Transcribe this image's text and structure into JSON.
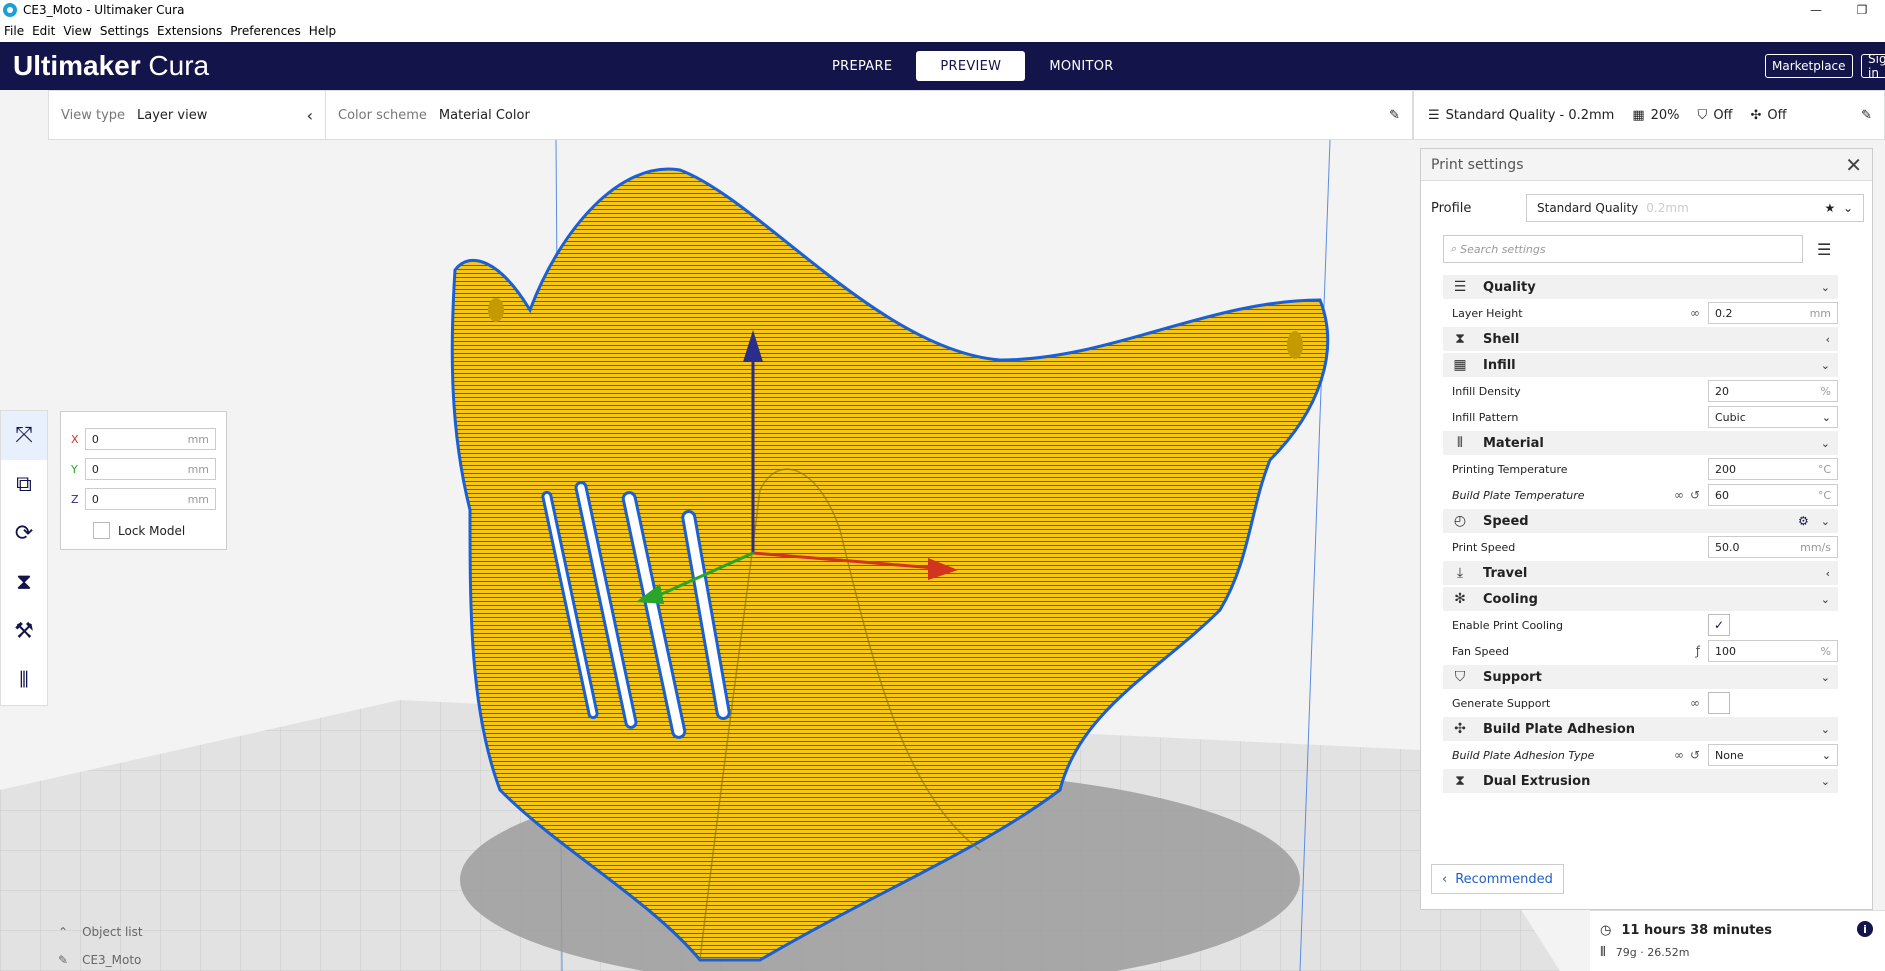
{
  "window": {
    "title": "CE3_Moto - Ultimaker Cura",
    "minimize": "—",
    "restore": "❐"
  },
  "menu": [
    "File",
    "Edit",
    "View",
    "Settings",
    "Extensions",
    "Preferences",
    "Help"
  ],
  "header": {
    "brand_bold": "Ultimaker",
    "brand_rest": " Cura",
    "tabs": [
      "PREPARE",
      "PREVIEW",
      "MONITOR"
    ],
    "active_tab": "PREVIEW",
    "marketplace": "Marketplace",
    "signin": "Sign in"
  },
  "view_bar": {
    "view_type_label": "View type",
    "view_type_value": "Layer view",
    "color_scheme_label": "Color scheme",
    "color_scheme_value": "Material Color"
  },
  "print_bar": {
    "profile": "Standard Quality - 0.2mm",
    "infill": "20%",
    "support": "Off",
    "adhesion": "Off"
  },
  "tools": [
    "move-tool",
    "scale-tool",
    "rotate-tool",
    "mirror-tool",
    "per-model-settings-tool",
    "support-blocker-tool"
  ],
  "move_panel": {
    "x_label": "X",
    "x_value": "0",
    "y_label": "Y",
    "y_value": "0",
    "z_label": "Z",
    "z_value": "0",
    "unit": "mm",
    "lock_label": "Lock Model",
    "lock_checked": false
  },
  "object_list": {
    "label": "Object list",
    "item": "CE3_Moto"
  },
  "settings_panel": {
    "title": "Print settings",
    "profile_label": "Profile",
    "profile_value": "Standard Quality",
    "profile_sub": "0.2mm",
    "search_placeholder": "Search settings",
    "categories": {
      "quality": "Quality",
      "shell": "Shell",
      "infill": "Infill",
      "material": "Material",
      "speed": "Speed",
      "travel": "Travel",
      "cooling": "Cooling",
      "support": "Support",
      "adhesion": "Build Plate Adhesion",
      "dual": "Dual Extrusion"
    },
    "settings": {
      "layer_height": {
        "label": "Layer Height",
        "value": "0.2",
        "unit": "mm"
      },
      "infill_density": {
        "label": "Infill Density",
        "value": "20",
        "unit": "%"
      },
      "infill_pattern": {
        "label": "Infill Pattern",
        "value": "Cubic"
      },
      "printing_temp": {
        "label": "Printing Temperature",
        "value": "200",
        "unit": "°C"
      },
      "bed_temp": {
        "label": "Build Plate Temperature",
        "value": "60",
        "unit": "°C"
      },
      "print_speed": {
        "label": "Print Speed",
        "value": "50.0",
        "unit": "mm/s"
      },
      "enable_cooling": {
        "label": "Enable Print Cooling",
        "checked": true
      },
      "fan_speed": {
        "label": "Fan Speed",
        "value": "100",
        "unit": "%"
      },
      "generate_support": {
        "label": "Generate Support",
        "checked": false
      },
      "adhesion_type": {
        "label": "Build Plate Adhesion Type",
        "value": "None"
      }
    },
    "recommended_label": "Recommended"
  },
  "estimate": {
    "time": "11 hours 38 minutes",
    "material": "79g · 26.52m"
  },
  "colors": {
    "header_bg": "#13144a",
    "model_yellow": "#f5c518",
    "outline_blue": "#1a5fd6",
    "accent_blue": "#1f5fc8"
  }
}
